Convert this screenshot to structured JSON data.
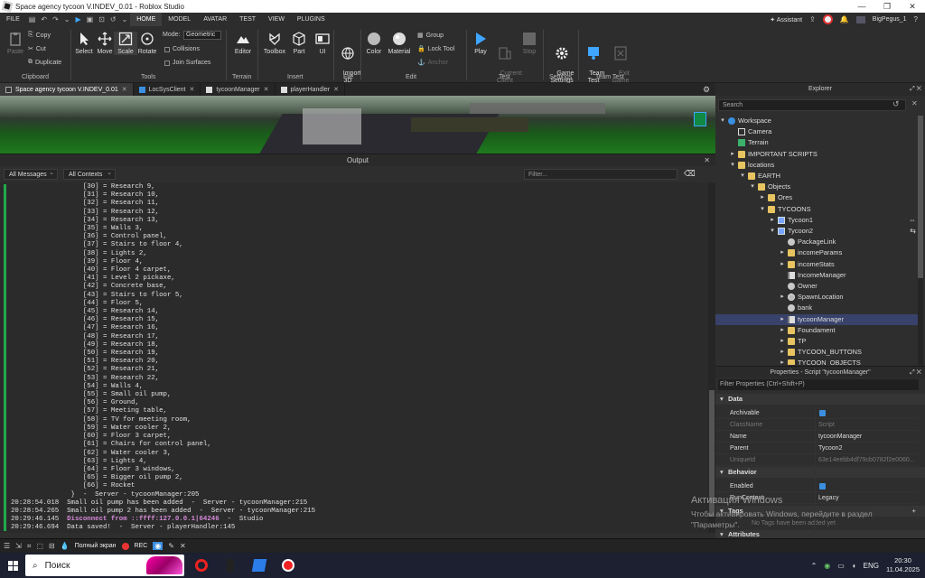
{
  "window": {
    "title": "Space agency tycoon V.INDEV_0.01 - Roblox Studio",
    "controls": [
      "—",
      "❐",
      "✕"
    ]
  },
  "menubar": {
    "file": "FILE",
    "tabs": [
      "HOME",
      "MODEL",
      "AVATAR",
      "TEST",
      "VIEW",
      "PLUGINS"
    ],
    "active_tab": "HOME",
    "assistant": "Assistant",
    "user": "BigPegus_1"
  },
  "ribbon": {
    "clipboard": {
      "paste": "Paste",
      "copy": "Copy",
      "cut": "Cut",
      "duplicate": "Duplicate",
      "label": "Clipboard"
    },
    "tools": {
      "select": "Select",
      "move": "Move",
      "scale": "Scale",
      "rotate": "Rotate",
      "mode_label": "Mode:",
      "mode_value": "Geometric",
      "collisions": "Collisions",
      "join_surfaces": "Join Surfaces",
      "label": "Tools"
    },
    "terrain": {
      "editor": "Editor",
      "label": "Terrain"
    },
    "insert": {
      "toolbox": "Toolbox",
      "part": "Part",
      "ui": "UI",
      "label": "Insert"
    },
    "file": {
      "import3d": "Import\n3D",
      "label": "File"
    },
    "edit": {
      "color": "Color",
      "material": "Material",
      "group": "Group",
      "lock_tool": "Lock Tool",
      "anchor": "Anchor",
      "label": "Edit"
    },
    "test": {
      "play": "Play",
      "current_client": "Current:\nClient",
      "stop": "Stop",
      "label": "Test"
    },
    "settings": {
      "game_settings": "Game\nSettings",
      "label": "Settings"
    },
    "team_test": {
      "team_test": "Team\nTest",
      "exit_game": "Exit\nGame",
      "label": "Team Test"
    }
  },
  "doc_tabs": [
    {
      "label": "Space agency tycoon V.INDEV_0.01",
      "active": true
    },
    {
      "label": "LocSysClient",
      "active": false
    },
    {
      "label": "tycoonManager",
      "active": false
    },
    {
      "label": "playerHandler",
      "active": false
    }
  ],
  "output": {
    "title": "Output",
    "filter_messages": "All Messages",
    "filter_contexts": "All Contexts",
    "filter_placeholder": "Filter...",
    "lines": [
      "                  [30] = Research 9,",
      "                  [31] = Research 10,",
      "                  [32] = Research 11,",
      "                  [33] = Research 12,",
      "                  [34] = Research 13,",
      "                  [35] = Walls 3,",
      "                  [36] = Control panel,",
      "                  [37] = Stairs to floor 4,",
      "                  [38] = Lights 2,",
      "                  [39] = Floor 4,",
      "                  [40] = Floor 4 carpet,",
      "                  [41] = Level 2 pickaxe,",
      "                  [42] = Concrete base,",
      "                  [43] = Stairs to floor 5,",
      "                  [44] = Floor 5,",
      "                  [45] = Research 14,",
      "                  [46] = Research 15,",
      "                  [47] = Research 16,",
      "                  [48] = Research 17,",
      "                  [49] = Research 18,",
      "                  [50] = Research 19,",
      "                  [51] = Research 20,",
      "                  [52] = Research 21,",
      "                  [53] = Research 22,",
      "                  [54] = Walls 4,",
      "                  [55] = Small oil pump,",
      "                  [56] = Ground,",
      "                  [57] = Meeting table,",
      "                  [58] = TV for meeting room,",
      "                  [59] = Water cooler 2,",
      "                  [60] = Floor 3 carpet,",
      "                  [61] = Chairs for control panel,",
      "                  [62] = Water cooler 3,",
      "                  [63] = Lights 4,",
      "                  [64] = Floor 3 windows,",
      "                  [65] = Bigger oil pump 2,",
      "                  [66] = Rocket",
      "               }  -  Server - tycoonManager:205",
      "20:28:54.018  Small oil pump has been added  -  Server - tycoonManager:215",
      "20:28:54.265  Small oil pump 2 has been added  -  Server - tycoonManager:215"
    ],
    "error_time": "20:29:46.145",
    "error_text": "Disconnect from ::ffff:127.0.0.1|64246",
    "error_suffix": "  -  Studio",
    "last_line": "20:29:46.694  Data saved!  -  Server - playerHandler:145"
  },
  "explorer": {
    "title": "Explorer",
    "search_placeholder": "Search",
    "items": [
      {
        "label": "Workspace",
        "depth": 0,
        "icon": "workspace",
        "arrow": "▾"
      },
      {
        "label": "Camera",
        "depth": 1,
        "icon": "camera",
        "arrow": ""
      },
      {
        "label": "Terrain",
        "depth": 1,
        "icon": "terrain",
        "arrow": ""
      },
      {
        "label": "IMPORTANT SCRIPTS",
        "depth": 1,
        "icon": "folder",
        "arrow": "▸"
      },
      {
        "label": "locations",
        "depth": 1,
        "icon": "folder",
        "arrow": "▾"
      },
      {
        "label": "EARTH",
        "depth": 2,
        "icon": "folder",
        "arrow": "▾"
      },
      {
        "label": "Objects",
        "depth": 3,
        "icon": "folder",
        "arrow": "▾"
      },
      {
        "label": "Ores",
        "depth": 4,
        "icon": "folder",
        "arrow": "▸"
      },
      {
        "label": "TYCOONS",
        "depth": 4,
        "icon": "folder",
        "arrow": "▾"
      },
      {
        "label": "Tycoon1",
        "depth": 5,
        "icon": "model",
        "arrow": "▸",
        "right": "⇔"
      },
      {
        "label": "Tycoon2",
        "depth": 5,
        "icon": "model",
        "arrow": "▾",
        "right": "⇆"
      },
      {
        "label": "PackageLink",
        "depth": 6,
        "icon": "value",
        "arrow": ""
      },
      {
        "label": "incomeParams",
        "depth": 6,
        "icon": "folder",
        "arrow": "▸"
      },
      {
        "label": "incomeStats",
        "depth": 6,
        "icon": "folder",
        "arrow": "▸"
      },
      {
        "label": "IncomeManager",
        "depth": 6,
        "icon": "script",
        "arrow": ""
      },
      {
        "label": "Owner",
        "depth": 6,
        "icon": "value",
        "arrow": ""
      },
      {
        "label": "SpawnLocation",
        "depth": 6,
        "icon": "spawn",
        "arrow": "▸"
      },
      {
        "label": "bank",
        "depth": 6,
        "icon": "value",
        "arrow": ""
      },
      {
        "label": "tycoonManager",
        "depth": 6,
        "icon": "script",
        "arrow": "▸",
        "selected": true
      },
      {
        "label": "Foundament",
        "depth": 6,
        "icon": "folder",
        "arrow": "▸"
      },
      {
        "label": "TP",
        "depth": 6,
        "icon": "folder",
        "arrow": "▸"
      },
      {
        "label": "TYCOON_BUTTONS",
        "depth": 6,
        "icon": "folder",
        "arrow": "▸"
      },
      {
        "label": "TYCOON_OBJECTS",
        "depth": 6,
        "icon": "folder",
        "arrow": "▸"
      }
    ]
  },
  "properties": {
    "title": "Properties - Script \"tycoonManager\"",
    "filter_placeholder": "Filter Properties (Ctrl+Shift+P)",
    "sections": {
      "data": "Data",
      "behavior": "Behavior",
      "tags": "Tags",
      "attributes": "Attributes"
    },
    "rows": {
      "archivable": "Archivable",
      "classname": "ClassName",
      "classname_value": "Script",
      "name": "Name",
      "name_value": "tycoonManager",
      "parent": "Parent",
      "parent_value": "Tycoon2",
      "uniqueid": "UniqueId",
      "uniqueid_value": "63e14eebb4df79cb0782f2e0060...",
      "enabled": "Enabled",
      "runcontext": "RunContext",
      "runcontext_value": "Legacy",
      "no_tags": "No Tags have been added yet"
    }
  },
  "watermark": {
    "line1": "Активация Windows",
    "line2": "Чтобы активировать Windows, перейдите в раздел",
    "line3": "\"Параметры\"."
  },
  "cmdbar": {
    "fullscreen": "Полный экран",
    "rec": "REC"
  },
  "taskbar": {
    "search": "Поиск",
    "lang": "ENG",
    "time": "20:30",
    "date": "11.04.2025"
  }
}
